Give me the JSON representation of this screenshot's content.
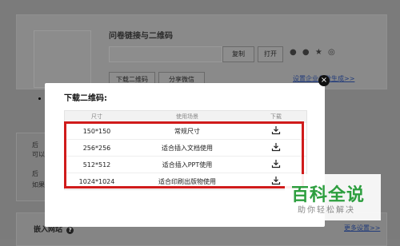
{
  "background": {
    "title": "问卷链接与二维码",
    "copy_button": "复制",
    "open_button": "打开",
    "download_qr_button": "下载二维码",
    "share_button": "分享微信",
    "settings_link": "设置企业参数生成>>",
    "more_settings_link": "更多设置>>",
    "side_text_1": "后",
    "side_text_2": "可以",
    "side_text_3": "后",
    "side_text_4": "如果",
    "embed_title": "嵌入网站"
  },
  "modal": {
    "title": "下载二维码:",
    "close_label": "×",
    "table": {
      "headers": [
        "尺寸",
        "使用场景",
        "下载"
      ],
      "rows": [
        {
          "size": "150*150",
          "scene": "常规尺寸"
        },
        {
          "size": "256*256",
          "scene": "适合插入文档使用"
        },
        {
          "size": "512*512",
          "scene": "适合插入PPT使用"
        },
        {
          "size": "1024*1024",
          "scene": "适合印刷出版物使用"
        }
      ]
    }
  },
  "watermark": {
    "main": "百科全说",
    "sub": "助你轻松解决"
  },
  "colors": {
    "highlight": "#d01b1b",
    "watermark_green": "#2c9e3e",
    "link_blue": "#213b7a"
  },
  "icons": {
    "download": "download-icon",
    "close": "close-icon",
    "help": "help-icon"
  }
}
